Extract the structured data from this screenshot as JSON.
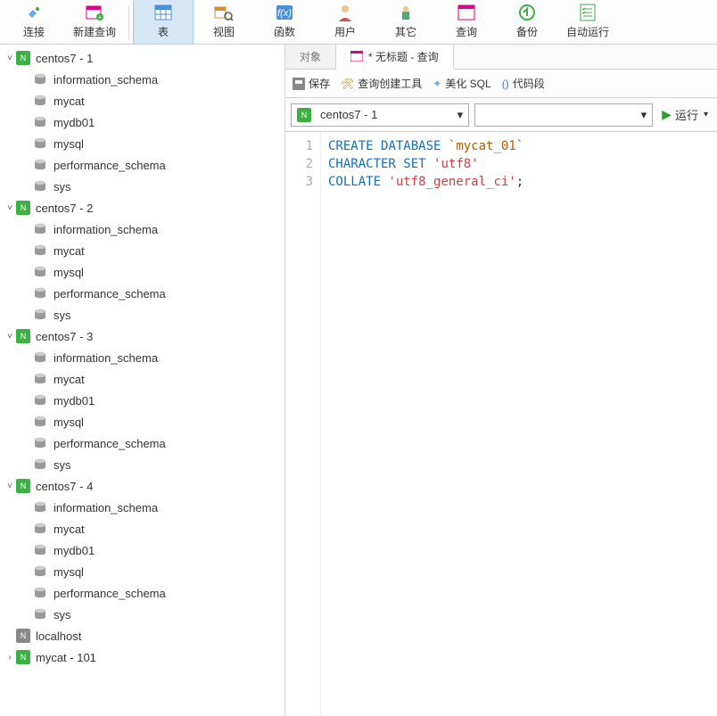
{
  "toolbar": {
    "connect": "连接",
    "new_query": "新建查询",
    "table": "表",
    "view": "视图",
    "function": "函数",
    "user": "用户",
    "other": "其它",
    "query": "查询",
    "backup": "备份",
    "auto_run": "自动运行"
  },
  "connections": [
    {
      "name": "centos7 - 1",
      "expanded": true,
      "active": true,
      "dbs": [
        "information_schema",
        "mycat",
        "mydb01",
        "mysql",
        "performance_schema",
        "sys"
      ]
    },
    {
      "name": "centos7 - 2",
      "expanded": true,
      "active": true,
      "dbs": [
        "information_schema",
        "mycat",
        "mysql",
        "performance_schema",
        "sys"
      ]
    },
    {
      "name": "centos7 - 3",
      "expanded": true,
      "active": true,
      "dbs": [
        "information_schema",
        "mycat",
        "mydb01",
        "mysql",
        "performance_schema",
        "sys"
      ]
    },
    {
      "name": "centos7 - 4",
      "expanded": true,
      "active": true,
      "dbs": [
        "information_schema",
        "mycat",
        "mydb01",
        "mysql",
        "performance_schema",
        "sys"
      ]
    },
    {
      "name": "localhost",
      "expanded": false,
      "active": false,
      "dbs": []
    },
    {
      "name": "mycat - 101",
      "expanded": false,
      "active": true,
      "dbs": []
    }
  ],
  "tabs": {
    "object": "对象",
    "query_tab": "* 无标题 - 查询"
  },
  "querybar": {
    "save": "保存",
    "builder": "查询创建工具",
    "beautify": "美化 SQL",
    "snippet": "代码段"
  },
  "combos": {
    "connection_value": "centos7 - 1",
    "database_value": "",
    "run": "运行"
  },
  "sql": {
    "lines": [
      "1",
      "2",
      "3"
    ],
    "l1": {
      "a": "CREATE",
      "b": "DATABASE",
      "c": "`mycat_01`"
    },
    "l2": {
      "a": "CHARACTER",
      "b": "SET",
      "c": "'utf8'"
    },
    "l3": {
      "a": "COLLATE",
      "b": "'utf8_general_ci'",
      "c": ";"
    }
  },
  "glyphs": {
    "down": "˅",
    "right": "›",
    "tri_down": "▾",
    "play": "▶"
  }
}
